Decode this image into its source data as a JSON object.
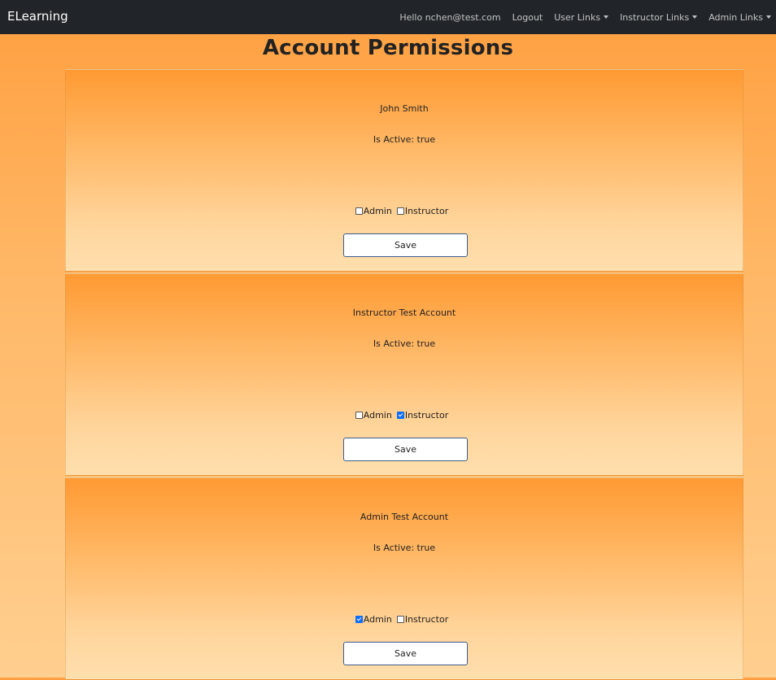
{
  "navbar": {
    "brand": "ELearning",
    "greeting": "Hello nchen@test.com",
    "logout": "Logout",
    "user_links": "User Links",
    "instructor_links": "Instructor Links",
    "admin_links": "Admin Links"
  },
  "page": {
    "title": "Account Permissions"
  },
  "accounts": [
    {
      "name": "John Smith",
      "active_text": "Is Active: true",
      "admin_label": "Admin",
      "admin_checked": false,
      "instructor_label": "Instructor",
      "instructor_checked": false,
      "save_label": "Save"
    },
    {
      "name": "Instructor Test Account",
      "active_text": "Is Active: true",
      "admin_label": "Admin",
      "admin_checked": false,
      "instructor_label": "Instructor",
      "instructor_checked": true,
      "save_label": "Save"
    },
    {
      "name": "Admin Test Account",
      "active_text": "Is Active: true",
      "admin_label": "Admin",
      "admin_checked": true,
      "instructor_label": "Instructor",
      "instructor_checked": false,
      "save_label": "Save"
    }
  ],
  "colors": {
    "navbar_bg": "#212529",
    "accent_orange": "#ff9f3f",
    "checkbox_checked": "#0d6efd"
  }
}
